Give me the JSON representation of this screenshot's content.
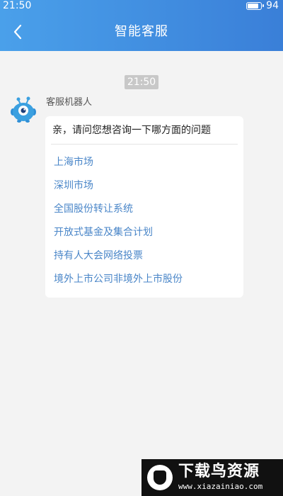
{
  "status_bar": {
    "time": "21:50",
    "battery_level": "94",
    "battery_fraction": 0.94
  },
  "nav": {
    "title": "智能客服",
    "back_icon": "chevron-left-icon"
  },
  "chat": {
    "timestamp": "21:50",
    "sender_name": "客服机器人",
    "avatar_icon": "robot-avatar-icon",
    "message": {
      "question": "亲，请问您想咨询一下哪方面的问题",
      "options": [
        "上海市场",
        "深圳市场",
        "全国股份转让系统",
        "开放式基金及集合计划",
        "持有人大会网络投票",
        "境外上市公司非境外上市股份"
      ]
    }
  },
  "watermark": {
    "title": "下载鸟资源",
    "url": "www.xiazainiao.com"
  },
  "colors": {
    "header_start": "#4aa0ea",
    "header_end": "#3a7fd8",
    "link": "#4a86c8",
    "background": "#f3f3f3"
  }
}
